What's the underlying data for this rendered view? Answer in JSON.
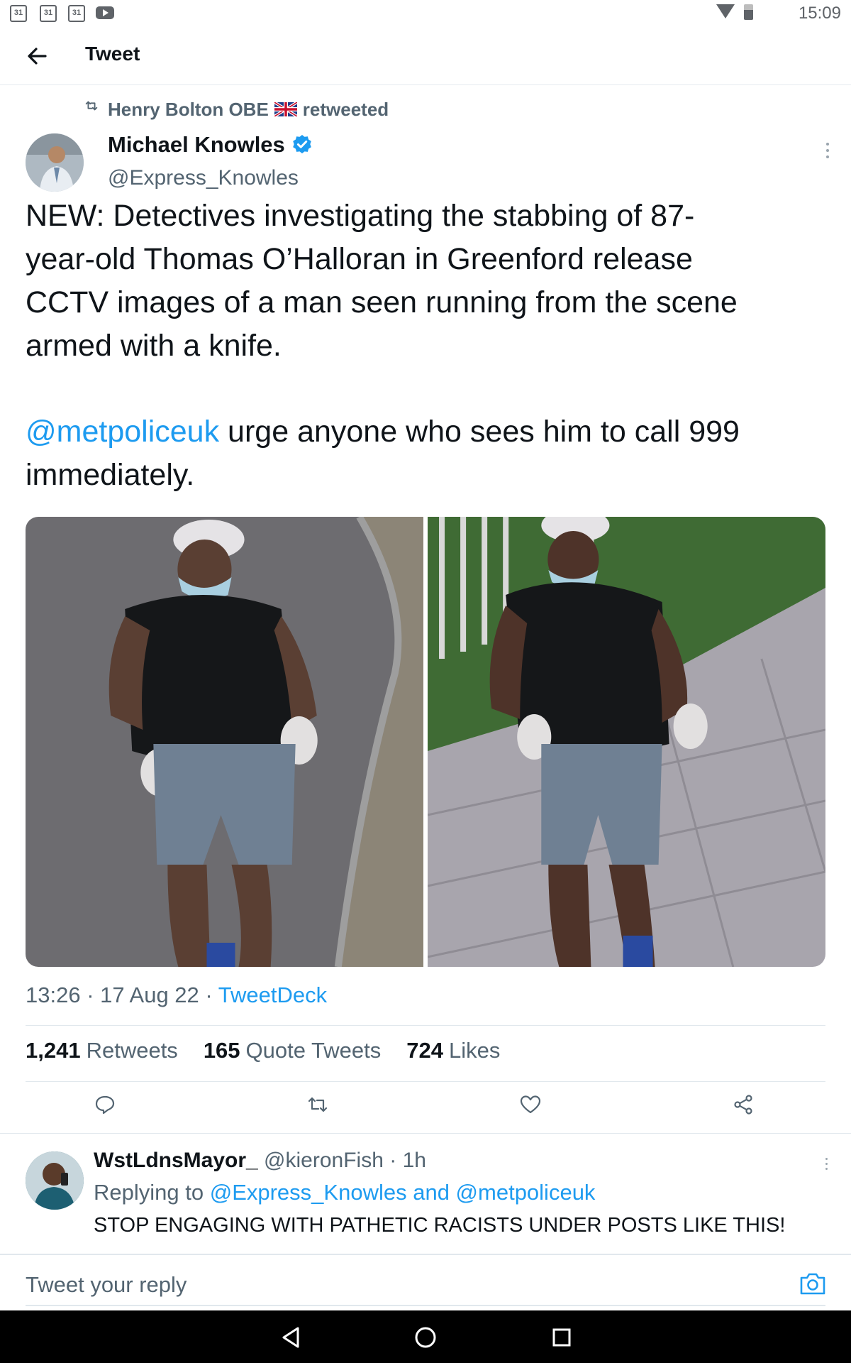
{
  "status_bar": {
    "calendar_icons": [
      "31",
      "31",
      "31"
    ],
    "youtube_icon": "youtube-icon",
    "wifi_icon": "wifi-icon",
    "battery_icon": "battery-icon",
    "time": "15:09"
  },
  "header": {
    "back_icon": "arrow-left-icon",
    "title": "Tweet"
  },
  "tweet": {
    "retweet_context": {
      "icon": "retweet-icon",
      "name": "Henry Bolton OBE",
      "flag": "uk-flag",
      "suffix": "retweeted"
    },
    "author": {
      "name": "Michael Knowles",
      "verified_icon": "verified-badge-icon",
      "handle": "@Express_Knowles"
    },
    "text_para1": "NEW: Detectives investigating the stabbing of 87-\nyear-old Thomas O’Halloran in Greenford release\nCCTV images of a man seen running from the scene\narmed with a knife.",
    "mention": "@metpoliceuk",
    "text_para2_rest": " urge anyone who sees him to call 999\nimmediately.",
    "meta": {
      "time": "13:26",
      "sep1": " · ",
      "date": "17 Aug 22",
      "sep2": " · ",
      "source": "TweetDeck"
    },
    "stats": [
      {
        "num": "1,241",
        "label": "Retweets"
      },
      {
        "num": "165",
        "label": "Quote Tweets"
      },
      {
        "num": "724",
        "label": "Likes"
      }
    ],
    "actions": [
      "reply-icon",
      "retweet-icon",
      "like-icon",
      "share-icon"
    ]
  },
  "reply": {
    "name": "WstLdnsMayor_",
    "handle": "@kieronFish",
    "sep": " · ",
    "time": "1h",
    "replying_prefix": "Replying to ",
    "replying_to_1": "@Express_Knowles",
    "replying_and": " and ",
    "replying_to_2": "@metpoliceuk",
    "text": "STOP ENGAGING WITH PATHETIC RACISTS UNDER POSTS LIKE THIS!"
  },
  "compose": {
    "placeholder": "Tweet your reply",
    "camera_icon": "camera-icon"
  },
  "nav_bar": {
    "back": "nav-back-icon",
    "home": "nav-home-icon",
    "recents": "nav-recents-icon"
  },
  "colors": {
    "accent": "#1d9bf0",
    "secondary_text": "#536471",
    "primary_text": "#0f1419"
  }
}
